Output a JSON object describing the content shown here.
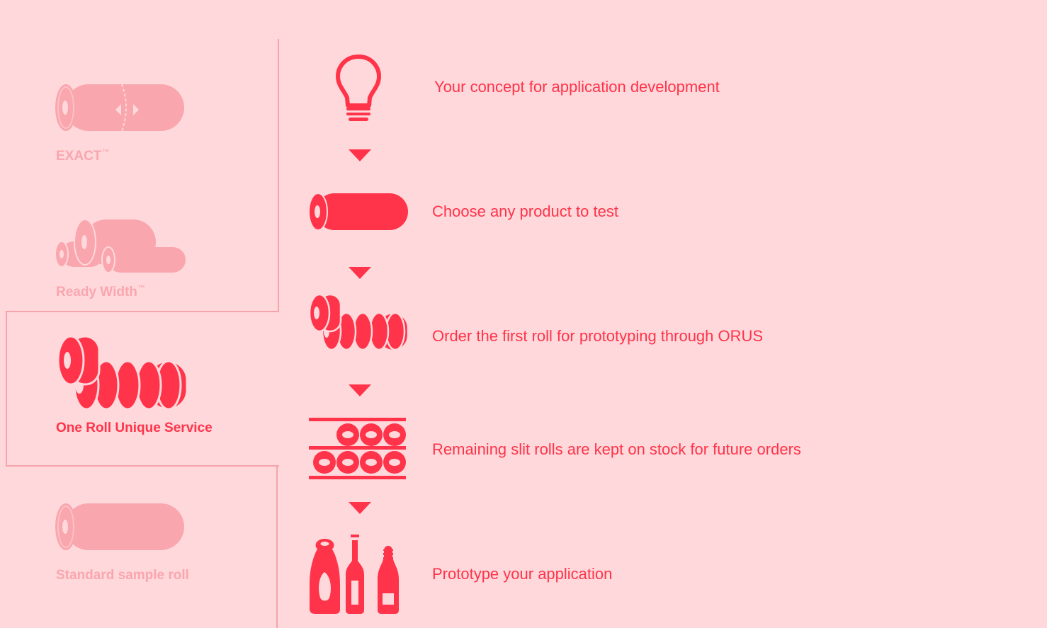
{
  "colors": {
    "background": "#ffd8db",
    "accent": "#ff3349",
    "muted": "#f9a6ae",
    "frame": "#f7a3ab"
  },
  "tabs": [
    {
      "label": "EXACT",
      "tm": "™",
      "icon": "roll-slit-arrows-icon",
      "active": false
    },
    {
      "label": "Ready Width",
      "tm": "™",
      "icon": "multiple-rolls-icon",
      "active": false
    },
    {
      "label": "One Roll Unique Service",
      "tm": "",
      "icon": "slit-rolls-icon",
      "active": true
    },
    {
      "label": "Standard sample roll",
      "tm": "",
      "icon": "single-roll-icon",
      "active": false
    }
  ],
  "steps": [
    {
      "label": "Your concept for application development",
      "icon": "lightbulb-icon"
    },
    {
      "label": "Choose any product to test",
      "icon": "roll-icon"
    },
    {
      "label": "Order the first roll for prototyping through ORUS",
      "icon": "slit-rolls-icon"
    },
    {
      "label": "Remaining slit rolls are kept on stock for future orders",
      "icon": "stock-shelf-icon"
    },
    {
      "label": "Prototype your application",
      "icon": "bottles-icon"
    }
  ]
}
